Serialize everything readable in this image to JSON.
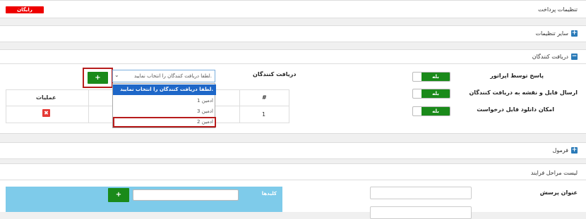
{
  "payment_settings": {
    "title": "تنظیمات پرداخت",
    "badge": "رایگان"
  },
  "other_settings": {
    "title": "سایر تنظیمات",
    "icon": "plus"
  },
  "recipients": {
    "title": "دریافت کنندگان",
    "icon": "minus",
    "rows": [
      {
        "label": "پاسخ توسط اپراتور",
        "toggle": "بله"
      },
      {
        "label": "ارسال فایل و نقشه به دریافت کنندگان",
        "toggle": "بله"
      },
      {
        "label": "امکان دانلود فایل درخواست",
        "toggle": "بله"
      }
    ],
    "field_label": "دریافت کنندگان",
    "select_placeholder": "لطفا دریافت کنندگان را انتخاب نمایید.",
    "add_button": "+",
    "dropdown_options": [
      "لطفا دریافت کنندگان را انتخاب نمایید.",
      "ادمین 1",
      "ادمین 3",
      "ادمین 2"
    ],
    "table": {
      "col_number": "#",
      "col_operations": "عملیات",
      "row_number": "1"
    }
  },
  "formula": {
    "title": "فرمول",
    "icon": "plus"
  },
  "process_steps": {
    "title": "لیست مراحل فرایند",
    "question_title_label": "عنوان پرسش",
    "keywords_label": "کلیدها",
    "add_button": "+"
  },
  "colors": {
    "accent_blue": "#2a7ab8",
    "success_green": "#1a8a1a",
    "danger_red": "#e53935",
    "highlight_red": "#b71c1c",
    "keyword_bar": "#7ecbea"
  }
}
